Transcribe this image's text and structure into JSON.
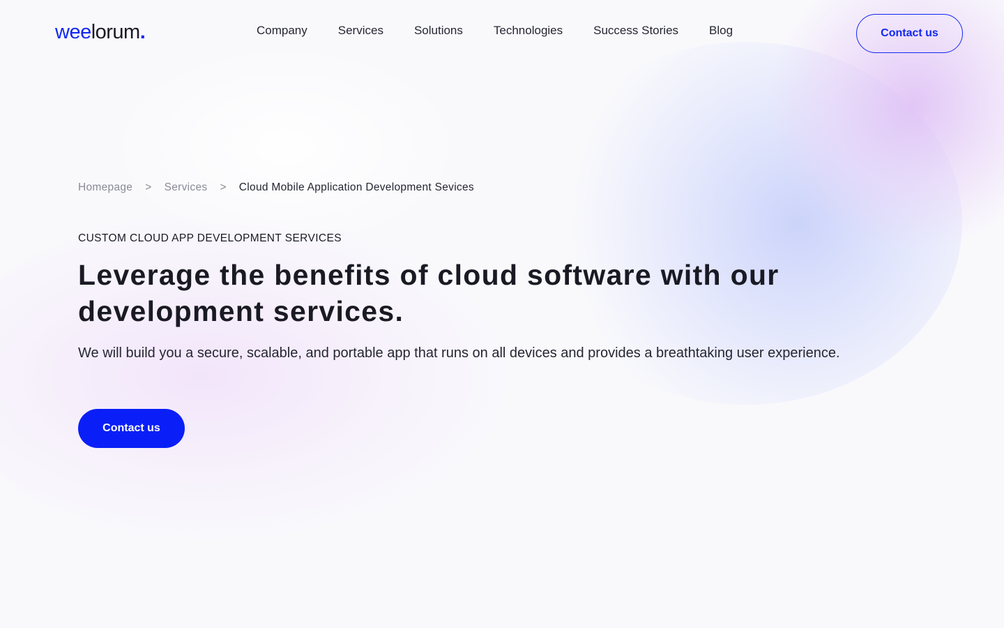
{
  "brand": {
    "logo_part1": "wee",
    "logo_part2": "lorum",
    "logo_dot": ".",
    "accent_color": "#1128f0"
  },
  "nav": {
    "items": [
      {
        "label": "Company"
      },
      {
        "label": "Services"
      },
      {
        "label": "Solutions"
      },
      {
        "label": "Technologies"
      },
      {
        "label": "Success Stories"
      },
      {
        "label": "Blog"
      }
    ],
    "cta_label": "Contact us"
  },
  "breadcrumb": {
    "items": [
      "Homepage",
      "Services"
    ],
    "separator": ">",
    "current": "Cloud Mobile Application Development Sevices"
  },
  "hero": {
    "eyebrow": "CUSTOM CLOUD APP DEVELOPMENT SERVICES",
    "title": "Leverage the benefits of cloud software with our development services.",
    "subtitle": "We will build you a secure, scalable, and portable app that runs on all devices and provides a breathtaking user experience.",
    "cta_label": "Contact us"
  }
}
